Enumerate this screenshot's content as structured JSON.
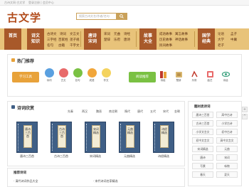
{
  "topbar": {
    "left_text": "古诗文网·古文学",
    "right_text": "登录注册 | 会员中心"
  },
  "header": {
    "logo": "古文学",
    "search_placeholder": "搜索古诗文名/作者/名句"
  },
  "nav": {
    "blocks": [
      "首页",
      "诗文\n知识",
      "唐诗\n宋词",
      "故事\n大全",
      "国学\n经典"
    ],
    "cells": [
      [
        "古诗文",
        "诗词",
        "文言文",
        "名句",
        "古籍"
      ],
      [
        "三字经",
        "百家姓",
        "弟子规",
        "千字文",
        "唐诗"
      ],
      [
        "宋词",
        "元曲",
        "诗经",
        "楚辞",
        "乐府"
      ],
      [
        "成语故事",
        "寓言故事",
        "历史故事",
        "神话故事",
        "民间故事"
      ],
      [
        "论语",
        "孟子",
        "大学",
        "中庸",
        "老子"
      ]
    ]
  },
  "hot": {
    "title": "热门推荐",
    "tool_label": "学习工具",
    "icons": [
      "诗词",
      "古文",
      "名句",
      "成语",
      "作文"
    ],
    "reading_label": "阅读推荐",
    "right_icons": [
      "诗经",
      "楚辞",
      "乐府",
      "曲艺",
      "诗话"
    ]
  },
  "poems": {
    "title": "诗词欣赏",
    "categories": [
      "先秦",
      "两汉",
      "魏晋",
      "南北朝",
      "隋代",
      "唐代",
      "五代",
      "宋代",
      "金朝",
      "元代",
      "明代",
      "清代",
      "近现代"
    ],
    "books": [
      {
        "label": "唐诗三百首",
        "caption": "唐诗三百首"
      },
      {
        "label": "古诗三百首",
        "caption": "古诗三百首"
      },
      {
        "label": "宋词精选",
        "caption": "宋词精选"
      },
      {
        "label": "元曲精选",
        "caption": "元曲精选"
      },
      {
        "label": "诗经精选",
        "caption": "诗经精选"
      }
    ]
  },
  "side": {
    "title": "题材类诗词",
    "tags": [
      "唐诗三百首",
      "高中古诗",
      "古诗三百首",
      "小学古诗",
      "小学文言文",
      "初中古诗",
      "初中文言文",
      "高中文言文",
      "宋词精选",
      "元曲",
      "唐诗",
      "宋词",
      "写景",
      "咏物",
      "春天",
      "夏天"
    ]
  },
  "bottom": {
    "title": "推荐诗词",
    "items": [
      "· 清代诗词作品大全",
      "· 宋代诗词名家精选"
    ]
  },
  "colors": {
    "accent": "#e8a23a",
    "brand": "#a8592a",
    "nav_bg": "#e8c37a",
    "book": "#3f5f86"
  }
}
